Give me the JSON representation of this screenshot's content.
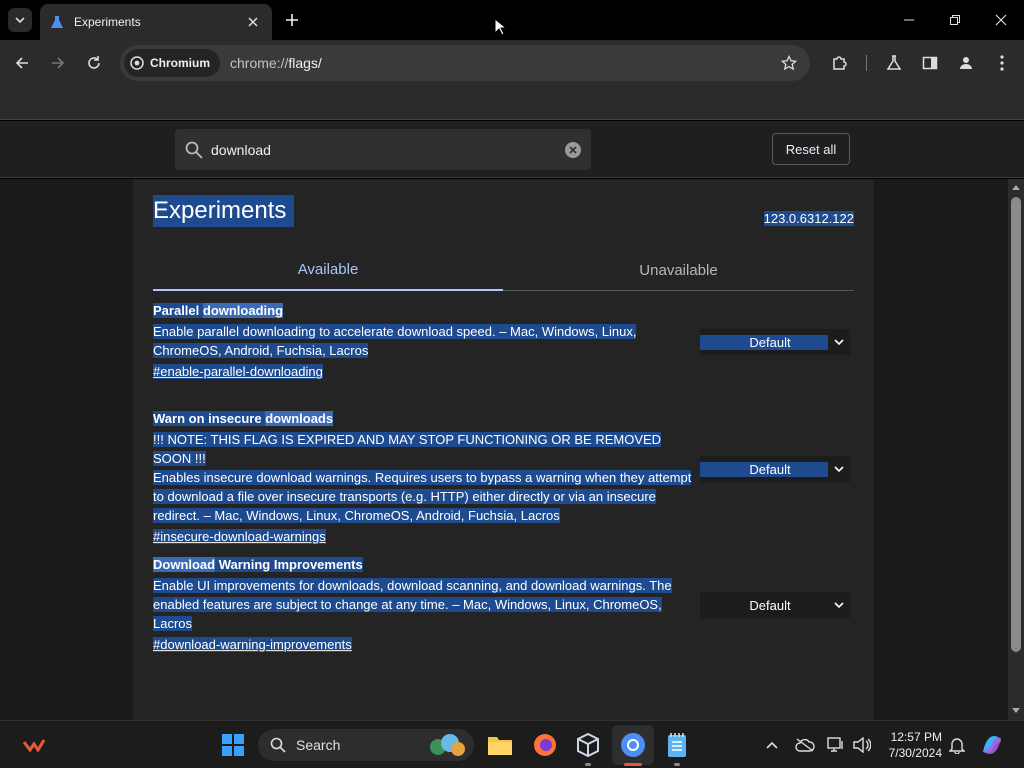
{
  "browser": {
    "tab_title": "Experiments",
    "chip_label": "Chromium",
    "url_prefix": "chrome://",
    "url_path": "flags/"
  },
  "flags_page": {
    "search_value": "download",
    "reset_label": "Reset all",
    "title": "Experiments",
    "version": "123.0.6312.122",
    "tabs": [
      {
        "label": "Available"
      },
      {
        "label": "Unavailable"
      }
    ],
    "flags": [
      {
        "name_pre": "Parallel ",
        "name_match": "downloading",
        "name_post": "",
        "desc": "Enable parallel downloading to accelerate download speed. – Mac, Windows, Linux, ChromeOS, Android, Fuchsia, Lacros",
        "note": "",
        "link": "#enable-parallel-downloading",
        "select_value": "Default"
      },
      {
        "name_pre": "Warn on insecure ",
        "name_match": "downloads",
        "name_post": "",
        "note": "!!! NOTE: THIS FLAG IS EXPIRED AND MAY STOP FUNCTIONING OR BE REMOVED SOON !!!",
        "desc": "Enables insecure download warnings. Requires users to bypass a warning when they attempt to download a file over insecure transports (e.g. HTTP) either directly or via an insecure redirect. – Mac, Windows, Linux, ChromeOS, Android, Fuchsia, Lacros",
        "link": "#insecure-download-warnings",
        "select_value": "Default"
      },
      {
        "name_pre": "",
        "name_match": "Download",
        "name_post": " Warning Improvements",
        "note": "",
        "desc": "Enable UI improvements for downloads, download scanning, and download warnings. The enabled features are subject to change at any time. – Mac, Windows, Linux, ChromeOS, Lacros",
        "link": "#download-warning-improvements",
        "select_value": "Default"
      }
    ]
  },
  "taskbar": {
    "search_label": "Search",
    "time": "12:57 PM",
    "date": "7/30/2024"
  },
  "colors": {
    "selection": "#1e4b8f",
    "accent": "#a8c7fa",
    "windows_blue": "#0a84ff",
    "pinned_red": "#e8583a"
  }
}
